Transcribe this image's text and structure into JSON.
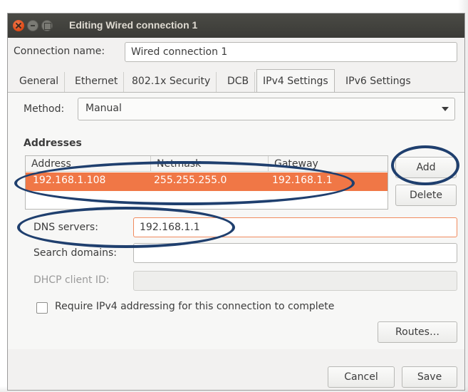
{
  "window": {
    "title": "Editing Wired connection 1"
  },
  "connection_name": {
    "label": "Connection name:",
    "value": "Wired connection 1"
  },
  "tabs": [
    {
      "label": "General"
    },
    {
      "label": "Ethernet"
    },
    {
      "label": "802.1x Security"
    },
    {
      "label": "DCB"
    },
    {
      "label": "IPv4 Settings"
    },
    {
      "label": "IPv6 Settings"
    }
  ],
  "active_tab": "IPv4 Settings",
  "method": {
    "label": "Method:",
    "value": "Manual"
  },
  "addresses": {
    "title": "Addresses",
    "columns": [
      "Address",
      "Netmask",
      "Gateway"
    ],
    "rows": [
      {
        "address": "192.168.1.108",
        "netmask": "255.255.255.0",
        "gateway": "192.168.1.1"
      }
    ],
    "add_label": "Add",
    "delete_label": "Delete"
  },
  "dns": {
    "label": "DNS servers:",
    "value": "192.168.1.1"
  },
  "search_domains": {
    "label": "Search domains:",
    "value": ""
  },
  "dhcp_client_id": {
    "label": "DHCP client ID:",
    "value": ""
  },
  "require_ipv4": {
    "label": "Require IPv4 addressing for this connection to complete",
    "checked": false
  },
  "buttons": {
    "routes": "Routes…",
    "cancel": "Cancel",
    "save": "Save"
  },
  "colors": {
    "accent": "#f07746",
    "annotation": "#1f3f6e",
    "titlebar": "#3b3b37"
  }
}
